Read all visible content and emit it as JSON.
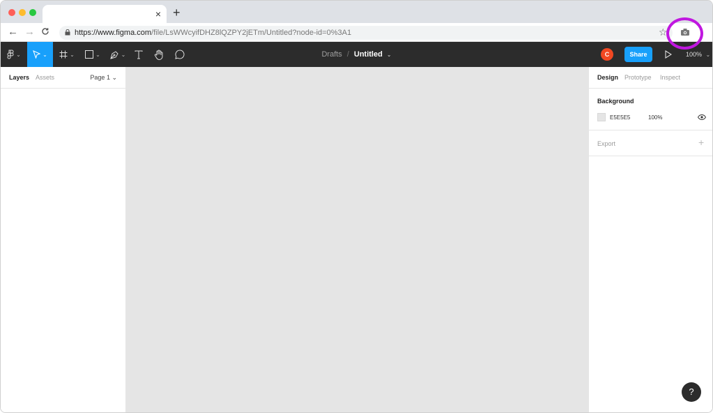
{
  "browser": {
    "tab_close": "×",
    "new_tab": "+",
    "nav_back": "←",
    "nav_forward": "→",
    "nav_reload": "C",
    "url_host": "https://www.figma.com",
    "url_path": "/file/LsWWcyifDHZ8lQZPY2jETm/Untitled?node-id=0%3A1",
    "star": "☆"
  },
  "figma": {
    "breadcrumb_drafts": "Drafts",
    "breadcrumb_sep": "/",
    "file_title": "Untitled",
    "avatar_initial": "C",
    "share_label": "Share",
    "zoom_label": "100%",
    "caret": "⌄"
  },
  "left_panel": {
    "tab_layers": "Layers",
    "tab_assets": "Assets",
    "page_label": "Page 1 ⌄"
  },
  "right_panel": {
    "tab_design": "Design",
    "tab_prototype": "Prototype",
    "tab_inspect": "Inspect",
    "background_title": "Background",
    "background_hex": "E5E5E5",
    "background_opacity": "100%",
    "export_title": "Export",
    "export_add": "+"
  },
  "help": {
    "label": "?"
  },
  "colors": {
    "toolbar_bg": "#2c2c2c",
    "accent": "#18a0fb",
    "canvas_bg": "#e5e5e5",
    "avatar": "#f24822",
    "highlight_ring": "#c017e0"
  },
  "icons": [
    "figma-menu-icon",
    "move-tool-icon",
    "frame-tool-icon",
    "shape-tool-icon",
    "pen-tool-icon",
    "text-tool-icon",
    "hand-tool-icon",
    "comment-tool-icon",
    "play-icon",
    "camera-icon",
    "lock-icon",
    "eye-icon"
  ]
}
